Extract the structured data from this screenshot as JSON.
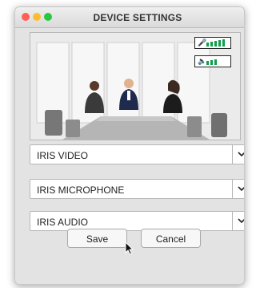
{
  "window": {
    "title": "DEVICE SETTINGS"
  },
  "video_preview": {
    "mic_icon": "microphone-icon",
    "speaker_icon": "speaker-icon",
    "mic_level_bars": 5,
    "mic_level_max": 5,
    "speaker_level_bars": 3,
    "speaker_level_max": 5,
    "level_color": "#0ca048"
  },
  "devices": {
    "video": {
      "value": "IRIS VIDEO"
    },
    "microphone": {
      "value": "IRIS MICROPHONE"
    },
    "audio": {
      "value": "IRIS AUDIO"
    }
  },
  "buttons": {
    "save_label": "Save",
    "cancel_label": "Cancel"
  }
}
